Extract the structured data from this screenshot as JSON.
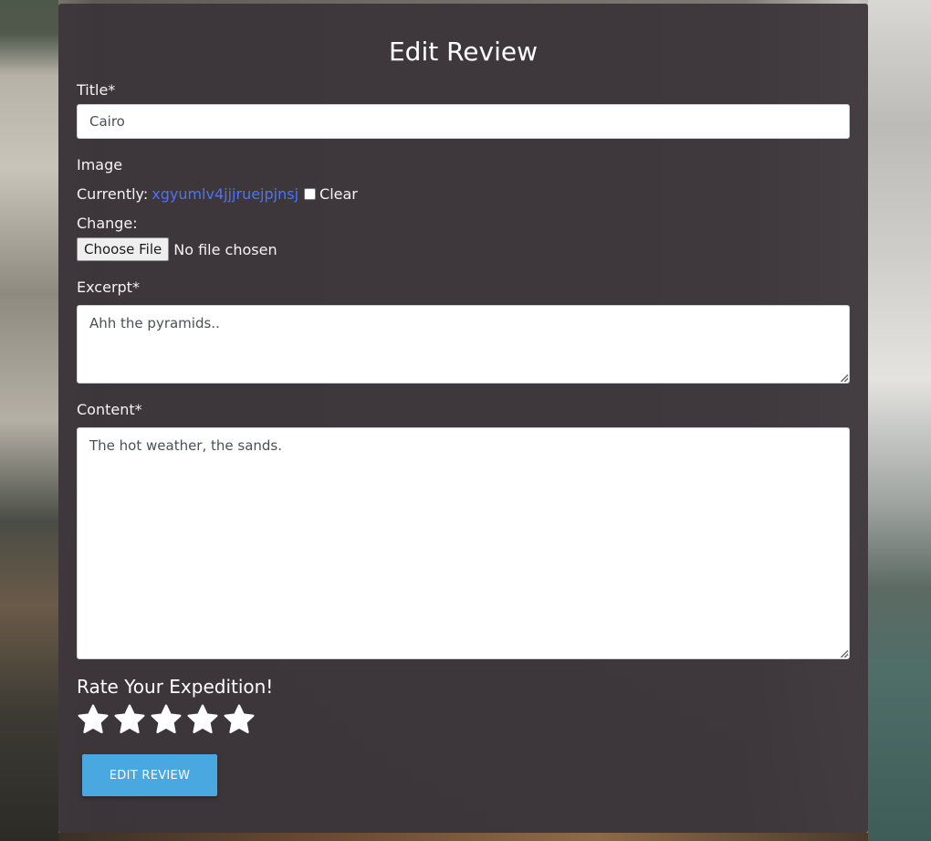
{
  "page": {
    "title": "Edit Review"
  },
  "form": {
    "title_label": "Title*",
    "title_value": "Cairo",
    "image_label": "Image",
    "currently_label": "Currently:",
    "current_file": "xgyumlv4jjjruejpjnsj",
    "clear_label": "Clear",
    "change_label": "Change:",
    "choose_file_label": "Choose File",
    "no_file_text": "No file chosen",
    "excerpt_label": "Excerpt*",
    "excerpt_value": "Ahh the pyramids..",
    "content_label": "Content*",
    "content_value": "The hot weather, the sands.",
    "rate_label": "Rate Your Expedition!",
    "rating_max": 5,
    "submit_label": "EDIT REVIEW"
  },
  "colors": {
    "accent_button": "#4aa8e0",
    "link": "#4a74f7",
    "card_background": "#3a3439",
    "star": "#ffffff"
  },
  "icons": {
    "star": "star-icon"
  }
}
